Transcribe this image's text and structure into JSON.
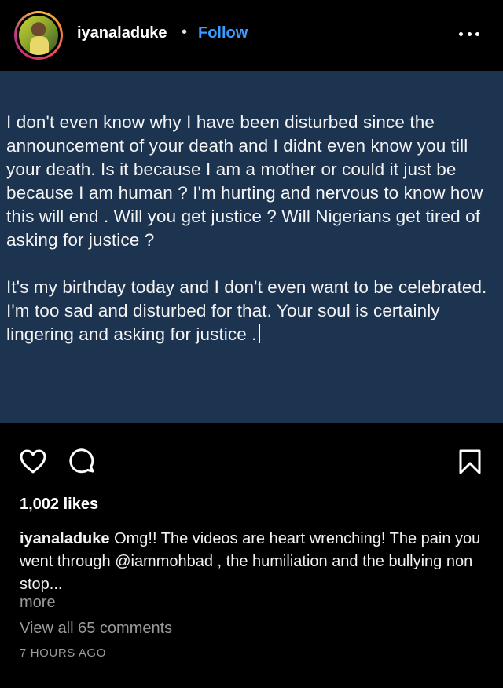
{
  "header": {
    "username": "iyanaladuke",
    "separator": "•",
    "follow_label": "Follow",
    "more_icon": "more-horizontal-icon"
  },
  "post": {
    "background_color": "#1d3451",
    "paragraphs": [
      "I don't even know why I have been disturbed since the announcement of your death and I didnt even know you till your death. Is it because I am a mother or could it just be because  I am human ? I'm hurting and nervous to know how this will end . Will you get justice ? Will Nigerians get tired of asking for justice ?",
      "It's my birthday today and I don't even want to be celebrated. I'm too sad and disturbed for that. Your soul is certainly lingering and asking for justice ."
    ]
  },
  "actions": {
    "like_icon": "heart-icon",
    "comment_icon": "comment-icon",
    "save_icon": "bookmark-icon"
  },
  "likes": "1,002 likes",
  "caption": {
    "username": "iyanaladuke",
    "text": "Omg!! The videos are heart wrenching! The pain you went through @iammohbad , the humiliation and the bullying non stop..."
  },
  "more_label": "more",
  "view_comments": "View all 65 comments",
  "timestamp": "7 HOURS AGO",
  "colors": {
    "background": "#000000",
    "link_blue": "#3d9cff",
    "muted_text": "#9a9a9a"
  }
}
